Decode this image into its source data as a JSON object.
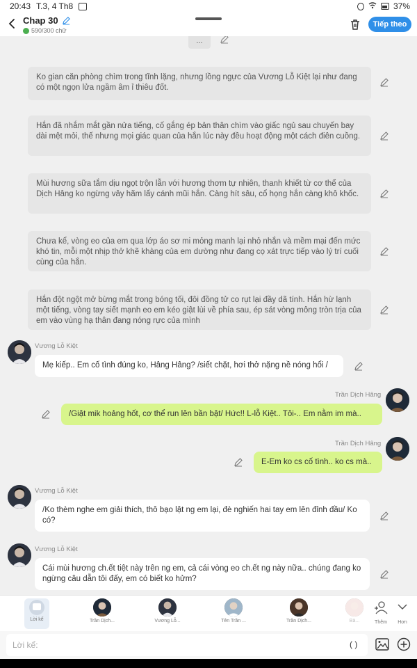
{
  "status_bar": {
    "time": "20:43",
    "date": "T.3, 4 Th8",
    "battery": "37%"
  },
  "header": {
    "title": "Chap 30",
    "counter": "590/300 chữ",
    "next_label": "Tiếp theo"
  },
  "more_chip": "...",
  "narration": [
    "Ko gian căn phòng chìm trong tĩnh lặng, nhưng lồng ngực của Vương Lỗ Kiệt lại như đang có một ngọn lửa ngầm âm ỉ thiêu đốt.",
    "Hắn đã nhắm mắt gần nửa tiếng, cố gắng ép bản thân chìm vào giấc ngủ sau chuyến bay dài mệt mỏi, thế nhưng mọi giác quan của hắn lúc này đều hoạt động một cách điên cuồng.",
    "Mùi hương sữa tắm dịu ngọt trộn lẫn với hương thơm tự nhiên, thanh khiết từ cơ thể của Dịch Hâng ko ngừng vây hãm lấy cánh mũi hắn. Càng hít sâu, cổ họng hắn càng khô khốc.",
    "Chưa kể, vòng eo của em qua lớp áo sơ mi mỏng manh lại nhỏ nhắn và mềm mại đến mức khó tin, mỗi một nhịp thở khẽ khàng của em dường như đang cọ xát trực tiếp vào lý trí cuối cùng của hắn.",
    "Hắn đột ngột mở bừng mắt trong bóng tối, đôi đồng tử co rụt lại đầy dã tính. Hắn hừ lạnh một tiếng, vòng tay siết mạnh eo em kéo giật lùi về phía sau, ép sát vòng mông tròn trịa của em vào vùng hạ thân đang nóng rực của mình"
  ],
  "messages": [
    {
      "sender": "Vương Lỗ Kiệt",
      "text": "Mẹ kiếp.. Em cố tình đúng ko, Hâng Hâng? /siết chặt, hơi thở nặng nề nóng hổi /"
    },
    {
      "sender": "Trần Dịch Hâng",
      "text": "/Giật mik hoảng hốt, cơ thể run lên bần bật/ Hức!! L-lỗ Kiệt..  Tôi-.. Em nằm im mà.."
    },
    {
      "sender": "Trần Dịch Hâng",
      "text": "E-Em ko cs cố tình.. ko cs mà.."
    },
    {
      "sender": "Vương Lỗ Kiệt",
      "text": "/Ko thèm nghe em giải thích, thô bạo lật ng em lại, đè nghiến hai tay em lên đỉnh đầu/ Ko có?"
    },
    {
      "sender": "Vương Lỗ Kiệt",
      "text": "Cái mùi hương ch.ết tiệt này trên ng em, cả cái vòng eo ch.ết ng này nữa.. chúng đang ko ngừng câu dẫn tôi đấy, em có biết ko hửm?"
    }
  ],
  "char_bar": {
    "items": [
      "Lời kể",
      "Trần Dịch...",
      "Vương Lỗ...",
      "Tên Trần ...",
      "Trần Dịch...",
      "Bà..."
    ],
    "add_label": "Thêm",
    "more_label": "Hơn"
  },
  "input": {
    "placeholder": "Lời kể:",
    "paren": "( )"
  },
  "colors": {
    "accent": "#2f8fe8",
    "outgoing_bubble": "#d8f58c",
    "narration_bg": "#e6e6e6"
  }
}
